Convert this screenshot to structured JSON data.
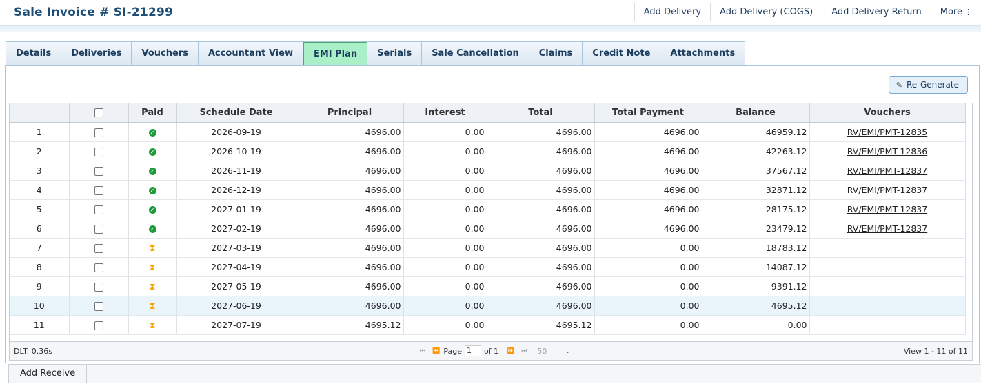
{
  "header": {
    "title": "Sale Invoice # SI-21299",
    "actions": [
      "Add Delivery",
      "Add Delivery (COGS)",
      "Add Delivery Return",
      "More"
    ]
  },
  "tabs": [
    "Details",
    "Deliveries",
    "Vouchers",
    "Accountant View",
    "EMI Plan",
    "Serials",
    "Sale Cancellation",
    "Claims",
    "Credit Note",
    "Attachments"
  ],
  "active_tab": "EMI Plan",
  "regenerate_label": "Re-Generate",
  "columns": [
    "",
    "",
    "Paid",
    "Schedule Date",
    "Principal",
    "Interest",
    "Total",
    "Total Payment",
    "Balance",
    "Vouchers"
  ],
  "rows": [
    {
      "no": "1",
      "paid": true,
      "date": "2026-09-19",
      "principal": "4696.00",
      "interest": "0.00",
      "total": "4696.00",
      "payment": "4696.00",
      "balance": "46959.12",
      "voucher": "RV/EMI/PMT-12835"
    },
    {
      "no": "2",
      "paid": true,
      "date": "2026-10-19",
      "principal": "4696.00",
      "interest": "0.00",
      "total": "4696.00",
      "payment": "4696.00",
      "balance": "42263.12",
      "voucher": "RV/EMI/PMT-12836"
    },
    {
      "no": "3",
      "paid": true,
      "date": "2026-11-19",
      "principal": "4696.00",
      "interest": "0.00",
      "total": "4696.00",
      "payment": "4696.00",
      "balance": "37567.12",
      "voucher": "RV/EMI/PMT-12837"
    },
    {
      "no": "4",
      "paid": true,
      "date": "2026-12-19",
      "principal": "4696.00",
      "interest": "0.00",
      "total": "4696.00",
      "payment": "4696.00",
      "balance": "32871.12",
      "voucher": "RV/EMI/PMT-12837"
    },
    {
      "no": "5",
      "paid": true,
      "date": "2027-01-19",
      "principal": "4696.00",
      "interest": "0.00",
      "total": "4696.00",
      "payment": "4696.00",
      "balance": "28175.12",
      "voucher": "RV/EMI/PMT-12837"
    },
    {
      "no": "6",
      "paid": true,
      "date": "2027-02-19",
      "principal": "4696.00",
      "interest": "0.00",
      "total": "4696.00",
      "payment": "4696.00",
      "balance": "23479.12",
      "voucher": "RV/EMI/PMT-12837"
    },
    {
      "no": "7",
      "paid": false,
      "date": "2027-03-19",
      "principal": "4696.00",
      "interest": "0.00",
      "total": "4696.00",
      "payment": "0.00",
      "balance": "18783.12",
      "voucher": ""
    },
    {
      "no": "8",
      "paid": false,
      "date": "2027-04-19",
      "principal": "4696.00",
      "interest": "0.00",
      "total": "4696.00",
      "payment": "0.00",
      "balance": "14087.12",
      "voucher": ""
    },
    {
      "no": "9",
      "paid": false,
      "date": "2027-05-19",
      "principal": "4696.00",
      "interest": "0.00",
      "total": "4696.00",
      "payment": "0.00",
      "balance": "9391.12",
      "voucher": ""
    },
    {
      "no": "10",
      "paid": false,
      "date": "2027-06-19",
      "principal": "4696.00",
      "interest": "0.00",
      "total": "4696.00",
      "payment": "0.00",
      "balance": "4695.12",
      "voucher": "",
      "highlight": true
    },
    {
      "no": "11",
      "paid": false,
      "date": "2027-07-19",
      "principal": "4695.12",
      "interest": "0.00",
      "total": "4695.12",
      "payment": "0.00",
      "balance": "0.00",
      "voucher": ""
    }
  ],
  "pager": {
    "dlt": "DLT: 0.36s",
    "page_label": "Page",
    "page_value": "1",
    "of_label": "of 1",
    "rows_per_page": "50",
    "view_info": "View 1 - 11 of 11"
  },
  "bottom": {
    "add_receive": "Add Receive"
  },
  "colors": {
    "title": "#1d4e78",
    "active_tab": "#a9f0c9",
    "paid_ok": "#1f9b3a",
    "pending": "#f5a40a"
  },
  "icons": {
    "paid": "check-circle-icon",
    "pending": "hourglass-icon",
    "regenerate": "pencil-icon"
  }
}
